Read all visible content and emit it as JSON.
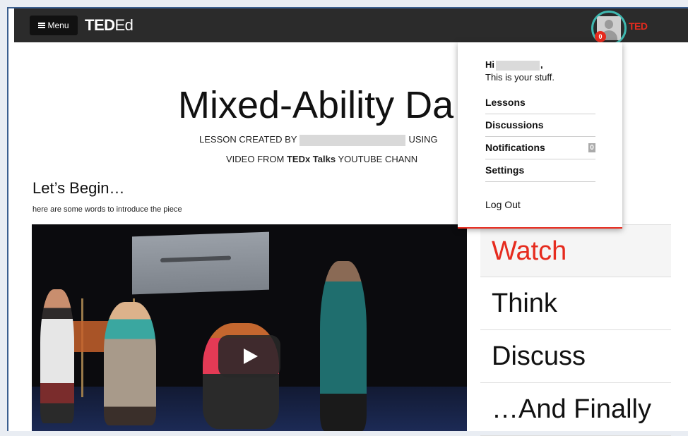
{
  "nav": {
    "menu_label": "Menu",
    "logo_ted": "TED",
    "logo_ed": "Ed",
    "notification_count": "0",
    "ted_mark": "TED"
  },
  "lesson": {
    "title": "Mixed-Ability Da",
    "created_by_prefix": "LESSON CREATED BY",
    "using_label": "USING",
    "video_from_prefix": "VIDEO FROM",
    "channel": "TEDx Talks",
    "channel_suffix": "YOUTUBE CHANN",
    "section_title": "Let’s Begin…",
    "intro_text": "here are some words to introduce the piece"
  },
  "side_nav": {
    "items": [
      {
        "label": "Watch",
        "active": true
      },
      {
        "label": "Think",
        "active": false
      },
      {
        "label": "Discuss",
        "active": false
      },
      {
        "label": "…And Finally",
        "active": false
      }
    ]
  },
  "dropdown": {
    "greeting": "Hi",
    "greeting_suffix": ",",
    "subtitle": "This is your stuff.",
    "items": [
      {
        "label": "Lessons"
      },
      {
        "label": "Discussions"
      },
      {
        "label": "Notifications",
        "count": "0"
      },
      {
        "label": "Settings"
      }
    ],
    "logout": "Log Out"
  },
  "colors": {
    "brand_red": "#e62b1e",
    "avatar_ring": "#3fb8b0",
    "topbar": "#2b2b2b"
  }
}
